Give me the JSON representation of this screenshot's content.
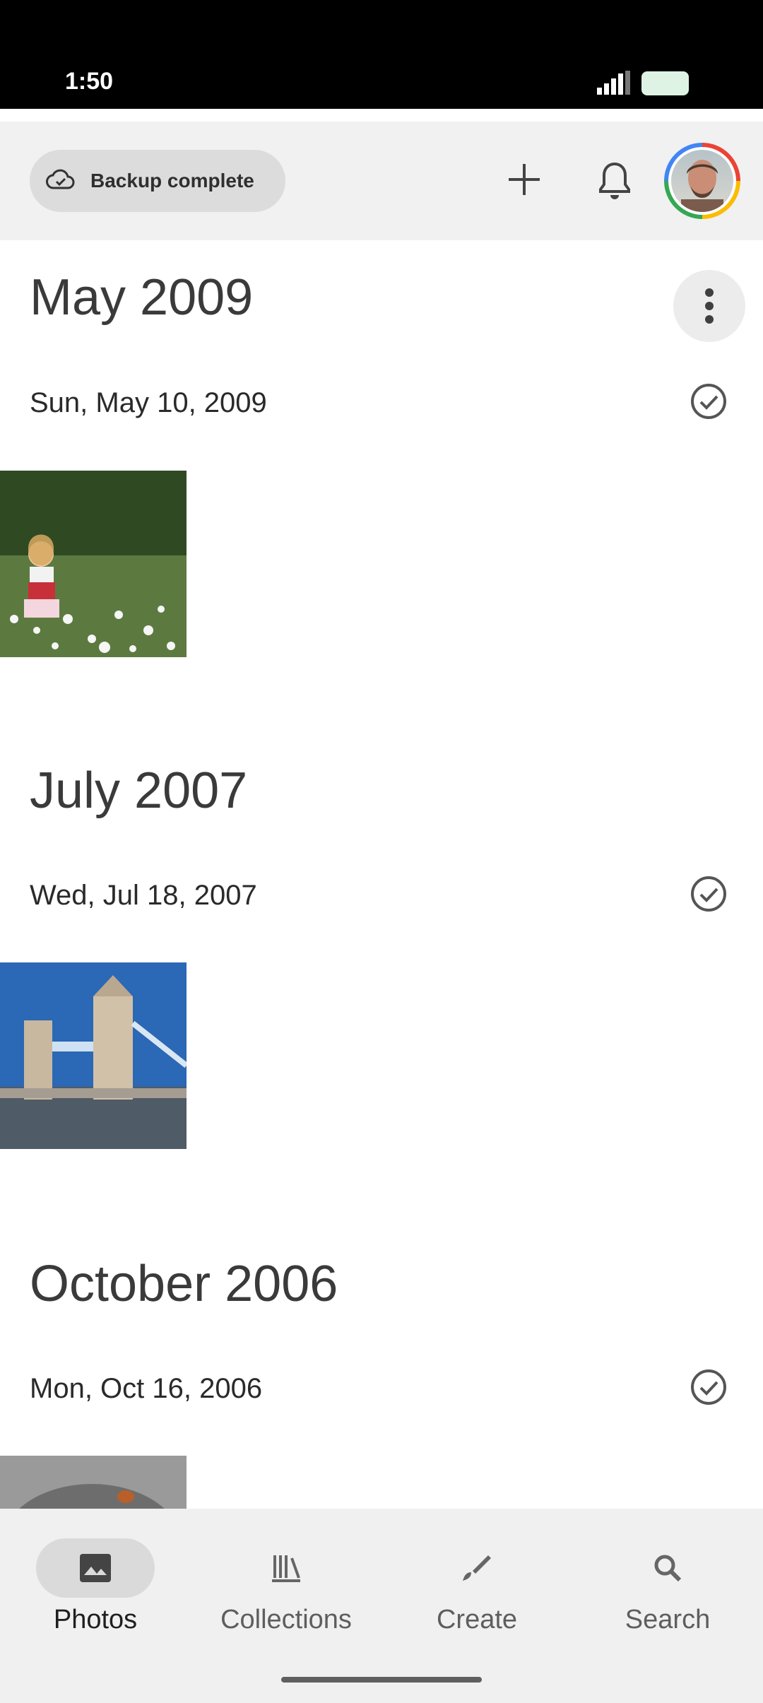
{
  "status_bar": {
    "time": "1:50"
  },
  "top_bar": {
    "backup_label": "Backup complete",
    "icons": [
      "cloud-check-icon",
      "add-icon",
      "bell-icon"
    ],
    "avatar": "account-avatar"
  },
  "timeline": {
    "sections": [
      {
        "month": "May 2009",
        "day": "Sun, May 10, 2009",
        "photo": "girl-in-flower-field"
      },
      {
        "month": "July 2007",
        "day": "Wed, Jul 18, 2007",
        "photo": "tower-bridge"
      },
      {
        "month": "October 2006",
        "day": "Mon, Oct 16, 2006",
        "photo": "dog-closeup"
      }
    ]
  },
  "bottom_nav": {
    "items": [
      {
        "label": "Photos",
        "icon": "photo-icon",
        "active": true
      },
      {
        "label": "Collections",
        "icon": "collections-icon",
        "active": false
      },
      {
        "label": "Create",
        "icon": "brush-icon",
        "active": false
      },
      {
        "label": "Search",
        "icon": "search-icon",
        "active": false
      }
    ]
  },
  "colors": {
    "accent_active_nav_pill": "#dadada",
    "top_bar_background": "#f1f1f1",
    "status_bar_background": "#000000"
  }
}
